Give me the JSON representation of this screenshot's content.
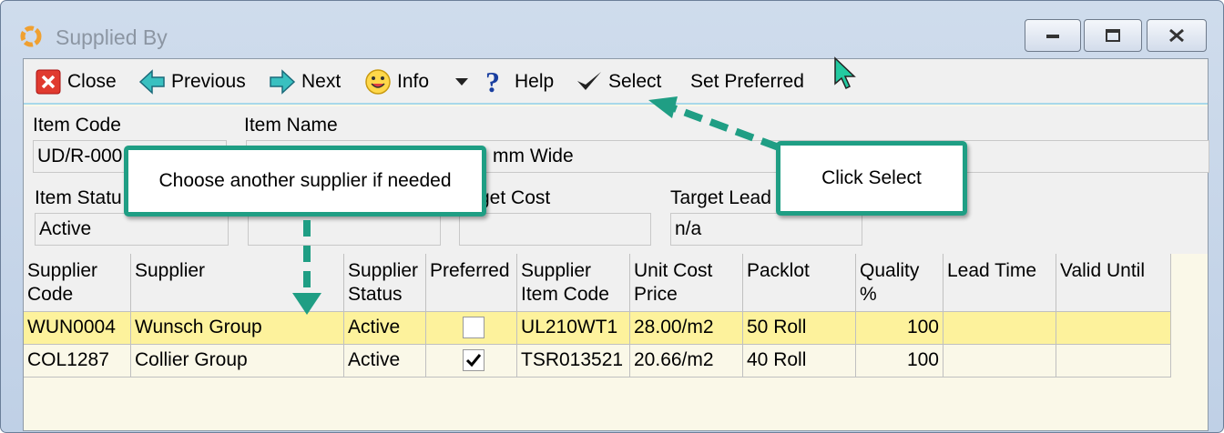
{
  "window": {
    "title": "Supplied By"
  },
  "toolbar": {
    "close": "Close",
    "previous": "Previous",
    "next": "Next",
    "info": "Info",
    "help": "Help",
    "select": "Select",
    "set_preferred": "Set Preferred"
  },
  "form": {
    "item_code_label": "Item Code",
    "item_code_value": "UD/R-000",
    "item_name_label": "Item Name",
    "item_name_value": "mm Wide",
    "item_status_label": "Item Statu",
    "item_status_value": "Active",
    "target_cost_label": "get Cost",
    "target_cost_value": "",
    "target_lead_label": "Target Lead",
    "target_lead_value": "n/a",
    "hidden_field_value": ""
  },
  "grid": {
    "columns": [
      [
        "Supplier",
        "Code"
      ],
      [
        "Supplier",
        ""
      ],
      [
        "Supplier",
        "Status"
      ],
      [
        "Preferred",
        ""
      ],
      [
        "Supplier",
        "Item Code"
      ],
      [
        "Unit Cost",
        "Price"
      ],
      [
        "Packlot",
        ""
      ],
      [
        "Quality",
        "%"
      ],
      [
        "Lead Time",
        ""
      ],
      [
        "Valid Until",
        ""
      ]
    ],
    "rows": [
      {
        "supplier_code": "WUN0004",
        "supplier": "Wunsch Group",
        "status": "Active",
        "preferred": false,
        "item_code": "UL210WT1",
        "unit_cost": "28.00/m2",
        "packlot": "50 Roll",
        "quality": "100",
        "lead_time": "",
        "valid_until": ""
      },
      {
        "supplier_code": "COL1287",
        "supplier": "Collier Group",
        "status": "Active",
        "preferred": true,
        "item_code": "TSR013521",
        "unit_cost": "20.66/m2",
        "packlot": "40 Roll",
        "quality": "100",
        "lead_time": "",
        "valid_until": ""
      }
    ]
  },
  "callouts": {
    "choose_supplier": "Choose another supplier if needed",
    "click_select": "Click Select"
  },
  "colors": {
    "callout_border": "#1f9e84",
    "selected_row": "#fdf29c",
    "toolbar_accent": "#a8d8ea"
  }
}
